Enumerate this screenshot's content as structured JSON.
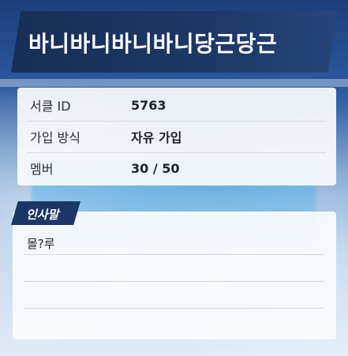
{
  "circle": {
    "name": "바니바니바니바니당근당근"
  },
  "info": {
    "rows": [
      {
        "label": "서클 ID",
        "value": "5763"
      },
      {
        "label": "가입 방식",
        "value": "자유 가입"
      },
      {
        "label": "멤버",
        "value": "30 / 50"
      }
    ]
  },
  "greeting": {
    "tab_label": "인사말",
    "message": "몰?루"
  }
}
